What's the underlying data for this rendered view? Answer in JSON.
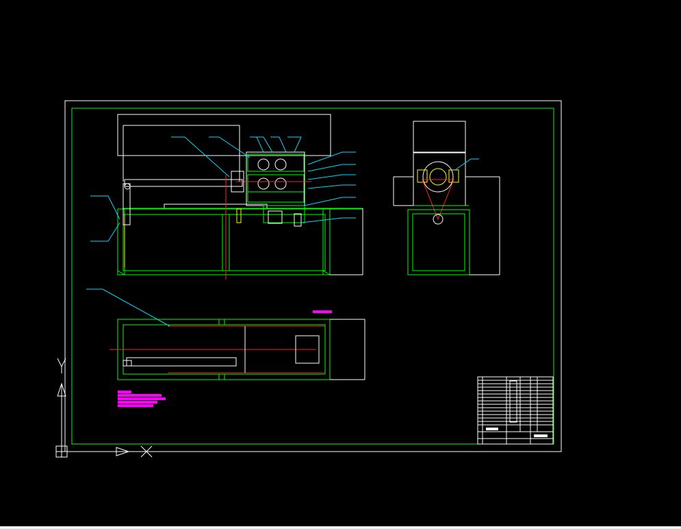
{
  "drawing": {
    "sheet_border_color": "#ffffff",
    "frame_color": "#00ff00",
    "leader_color": "#00d8ff",
    "centerline_color": "#ff2020",
    "highlight_color": "#ff00ff",
    "background": "#000000"
  },
  "ucs": {
    "icon": "ucs-axis-icon",
    "x_axis_icon": "x-axis-arrow-icon",
    "y_axis_icon": "y-axis-arrow-icon"
  },
  "views": [
    {
      "name": "front-elevation-view"
    },
    {
      "name": "side-elevation-view"
    },
    {
      "name": "top-plan-view"
    }
  ],
  "title_block": {
    "rows": 16,
    "columns": 6
  }
}
